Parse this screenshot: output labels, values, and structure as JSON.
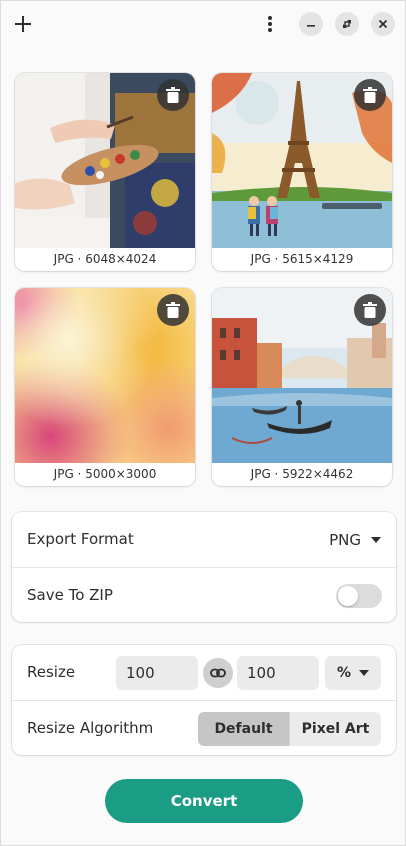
{
  "header": {
    "add_icon": "plus-icon",
    "menu_icon": "vertical-dots-icon",
    "window_controls": [
      "minimize-icon",
      "maximize-icon",
      "close-icon"
    ]
  },
  "images": [
    {
      "caption": "JPG · 6048×4024",
      "subject": "hand-holding-paint-palette"
    },
    {
      "caption": "JPG · 5615×4129",
      "subject": "eiffel-tower-watercolor"
    },
    {
      "caption": "JPG · 5000×3000",
      "subject": "abstract-watercolor-clouds"
    },
    {
      "caption": "JPG · 5922×4462",
      "subject": "venice-gondola-watercolor"
    }
  ],
  "export": {
    "format_label": "Export Format",
    "format_value": "PNG",
    "zip_label": "Save To ZIP",
    "zip_enabled": false
  },
  "resize": {
    "label": "Resize",
    "width": "100",
    "height": "100",
    "unit": "%",
    "algorithm_label": "Resize Algorithm",
    "algorithm_options": [
      "Default",
      "Pixel Art"
    ],
    "algorithm_selected": "Default"
  },
  "convert_label": "Convert",
  "colors": {
    "accent": "#1a9c85",
    "background": "#fafafa",
    "card": "#ffffff"
  }
}
